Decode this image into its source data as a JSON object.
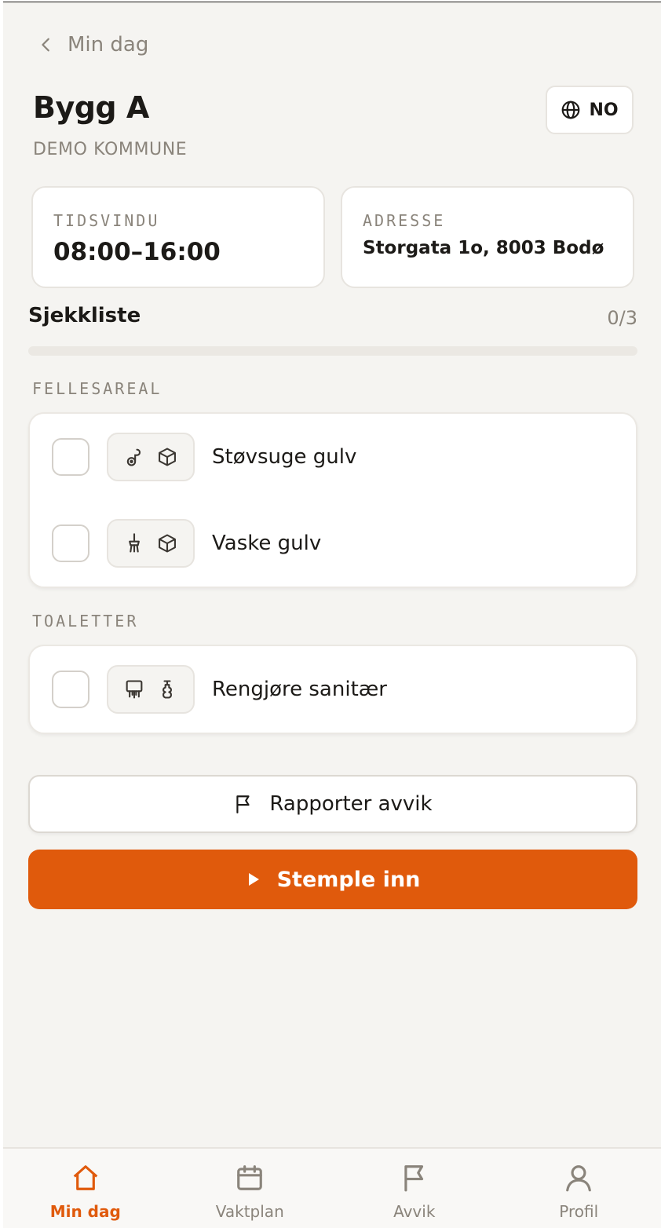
{
  "nav": {
    "back_label": "Min dag"
  },
  "header": {
    "title": "Bygg A",
    "subtitle": "DEMO KOMMUNE",
    "language": "NO"
  },
  "info": {
    "time_window": {
      "label": "TIDSVINDU",
      "value": "08:00–16:00"
    },
    "address": {
      "label": "ADRESSE",
      "value": "Storgata 1o, 8003 Bodø"
    }
  },
  "checklist": {
    "title": "Sjekkliste",
    "count": "0/3",
    "progress_fraction": 0,
    "groups": [
      {
        "label": "FELLESAREAL",
        "tasks": [
          {
            "label": "Støvsuge gulv",
            "icons": [
              "vacuum-icon",
              "box-icon"
            ]
          },
          {
            "label": "Vaske gulv",
            "icons": [
              "mop-icon",
              "box-icon"
            ]
          }
        ]
      },
      {
        "label": "TOALETTER",
        "tasks": [
          {
            "label": "Rengjøre sanitær",
            "icons": [
              "brush-icon",
              "spray-bottle-icon"
            ]
          }
        ]
      }
    ]
  },
  "actions": {
    "report_label": "Rapporter avvik",
    "clock_in_label": "Stemple inn"
  },
  "tabs": [
    {
      "label": "Min dag",
      "icon": "home-icon",
      "active": true
    },
    {
      "label": "Vaktplan",
      "icon": "calendar-icon",
      "active": false
    },
    {
      "label": "Avvik",
      "icon": "flag-icon",
      "active": false
    },
    {
      "label": "Profil",
      "icon": "person-icon",
      "active": false
    }
  ],
  "colors": {
    "accent": "#e05a0c",
    "background": "#f5f4f1",
    "muted": "#8a847b"
  }
}
